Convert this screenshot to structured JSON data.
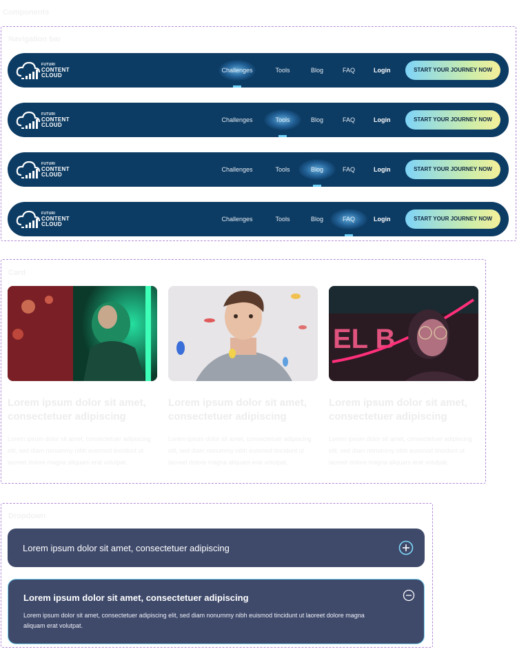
{
  "labels": {
    "page": "Components",
    "nav_section": "Navigation bar",
    "card_section": "Card",
    "dropdown_section": "Dropdown"
  },
  "logo": {
    "line1": "FUTURI",
    "line2": "CONTENT",
    "line3": "CLOUD"
  },
  "nav": {
    "items": [
      "Challenges",
      "Tools",
      "Blog",
      "FAQ"
    ],
    "login": "Login",
    "cta": "START YOUR JOURNEY NOW",
    "bars": [
      {
        "active": "Challenges"
      },
      {
        "active": "Tools"
      },
      {
        "active": "Blog"
      },
      {
        "active": "FAQ"
      }
    ]
  },
  "cards": [
    {
      "title": "Lorem ipsum dolor sit amet, consectetuer adipiscing",
      "body": "Lorem ipsum dolor sit amet, consectetuer adipiscing elit, sed diam nonummy nibh euismod tincidunt ut laoreet dolore magna aliquam erat volutpat.",
      "image": "woman-green-neon-photo"
    },
    {
      "title": "Lorem ipsum dolor sit amet, consectetuer adipiscing",
      "body": "Lorem ipsum dolor sit amet, consectetuer adipiscing elit, sed diam nonummy nibh euismod tincidunt ut laoreet dolore magna aliquam erat volutpat.",
      "image": "man-confetti-photo"
    },
    {
      "title": "Lorem ipsum dolor sit amet, consectetuer adipiscing",
      "body": "Lorem ipsum dolor sit amet, consectetuer adipiscing elit, sed diam nonummy nibh euismod tincidunt ut laoreet dolore magna aliquam erat volutpat.",
      "image": "woman-pink-neon-photo"
    }
  ],
  "dropdowns": [
    {
      "question": "Lorem ipsum dolor sit amet, consectetuer adipiscing",
      "expanded": false,
      "icon": "plus-circle-icon"
    },
    {
      "question": "Lorem ipsum dolor sit amet, consectetuer adipiscing",
      "expanded": true,
      "icon": "minus-circle-icon",
      "answer": "Lorem ipsum dolor sit amet, consectetuer adipiscing elit, sed diam nonummy nibh euismod tincidunt ut laoreet dolore magna aliquam erat volutpat."
    }
  ],
  "colors": {
    "navbar": "#0c3b63",
    "accordion": "#3f4a6b",
    "accent": "#6fd0f5",
    "section_border": "#b08ad8"
  }
}
